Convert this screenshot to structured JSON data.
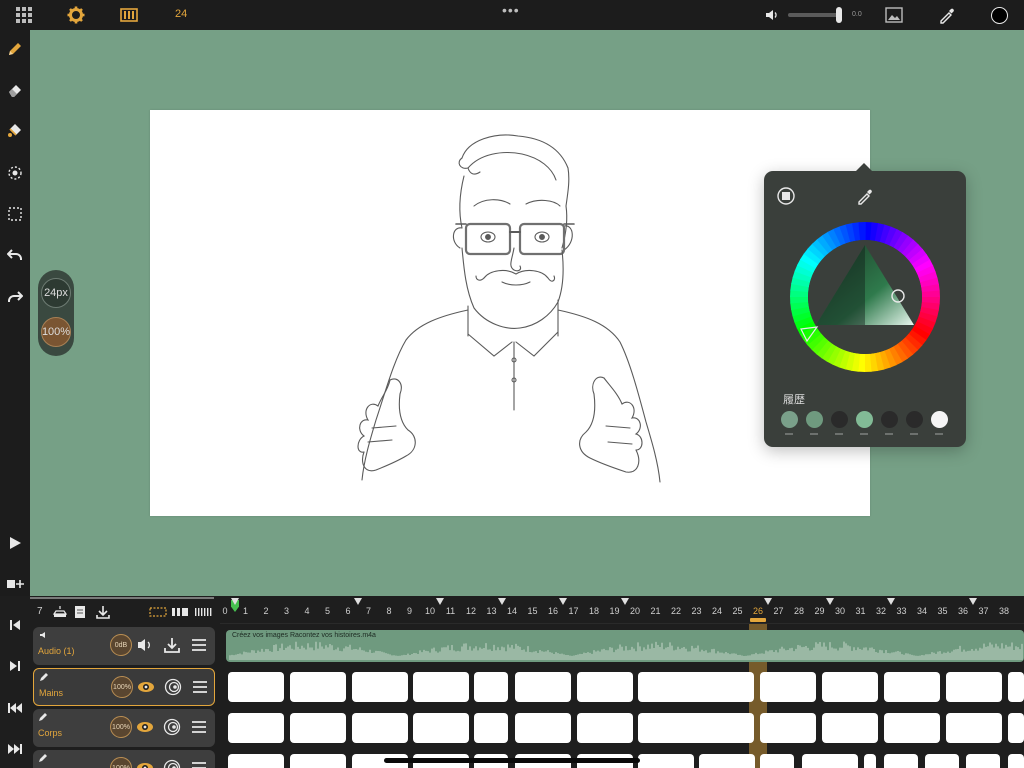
{
  "topbar": {
    "frame_count": "24",
    "volume_value": "0.0",
    "volume_level": 1.0,
    "icons": [
      "grid-icon",
      "gear-icon",
      "film-icon",
      "speaker-icon",
      "image-icon",
      "eyedropper-icon"
    ],
    "current_color": "#000000"
  },
  "left_toolbar": {
    "tools": [
      "pencil-icon",
      "eraser-icon",
      "paint-bucket-icon",
      "lasso-icon",
      "selection-icon",
      "undo-icon",
      "redo-icon"
    ],
    "bottom": [
      "play-icon",
      "add-frame-icon"
    ]
  },
  "brush": {
    "size": "24px",
    "opacity": "100%"
  },
  "color_popover": {
    "history_label": "履歴",
    "history_colors": [
      "#7aa08a",
      "#6f9a7f",
      "#2a2a2a",
      "#82bb96",
      "#2a2a2a",
      "#2a2a2a",
      "#f5f5f5"
    ]
  },
  "timeline": {
    "layer_count": "7",
    "ruler_ticks": [
      "0",
      "1",
      "2",
      "3",
      "4",
      "5",
      "6",
      "7",
      "8",
      "9",
      "10",
      "11",
      "12",
      "13",
      "14",
      "15",
      "16",
      "17",
      "18",
      "19",
      "20",
      "21",
      "22",
      "23",
      "24",
      "25",
      "26",
      "27",
      "28",
      "29",
      "30",
      "31",
      "32",
      "33",
      "34",
      "35",
      "36",
      "37",
      "38"
    ],
    "current_frame": "26",
    "tracks": [
      {
        "name": "Audio (1)",
        "opacity": "0dB",
        "type": "audio"
      },
      {
        "name": "Mains",
        "opacity": "100%",
        "type": "drawing",
        "selected": true
      },
      {
        "name": "Corps",
        "opacity": "100%",
        "type": "drawing"
      },
      {
        "name": "",
        "opacity": "100%",
        "type": "drawing"
      }
    ],
    "audio_clip_label": "Créez vos images Racontez vos histoires.m4a"
  }
}
